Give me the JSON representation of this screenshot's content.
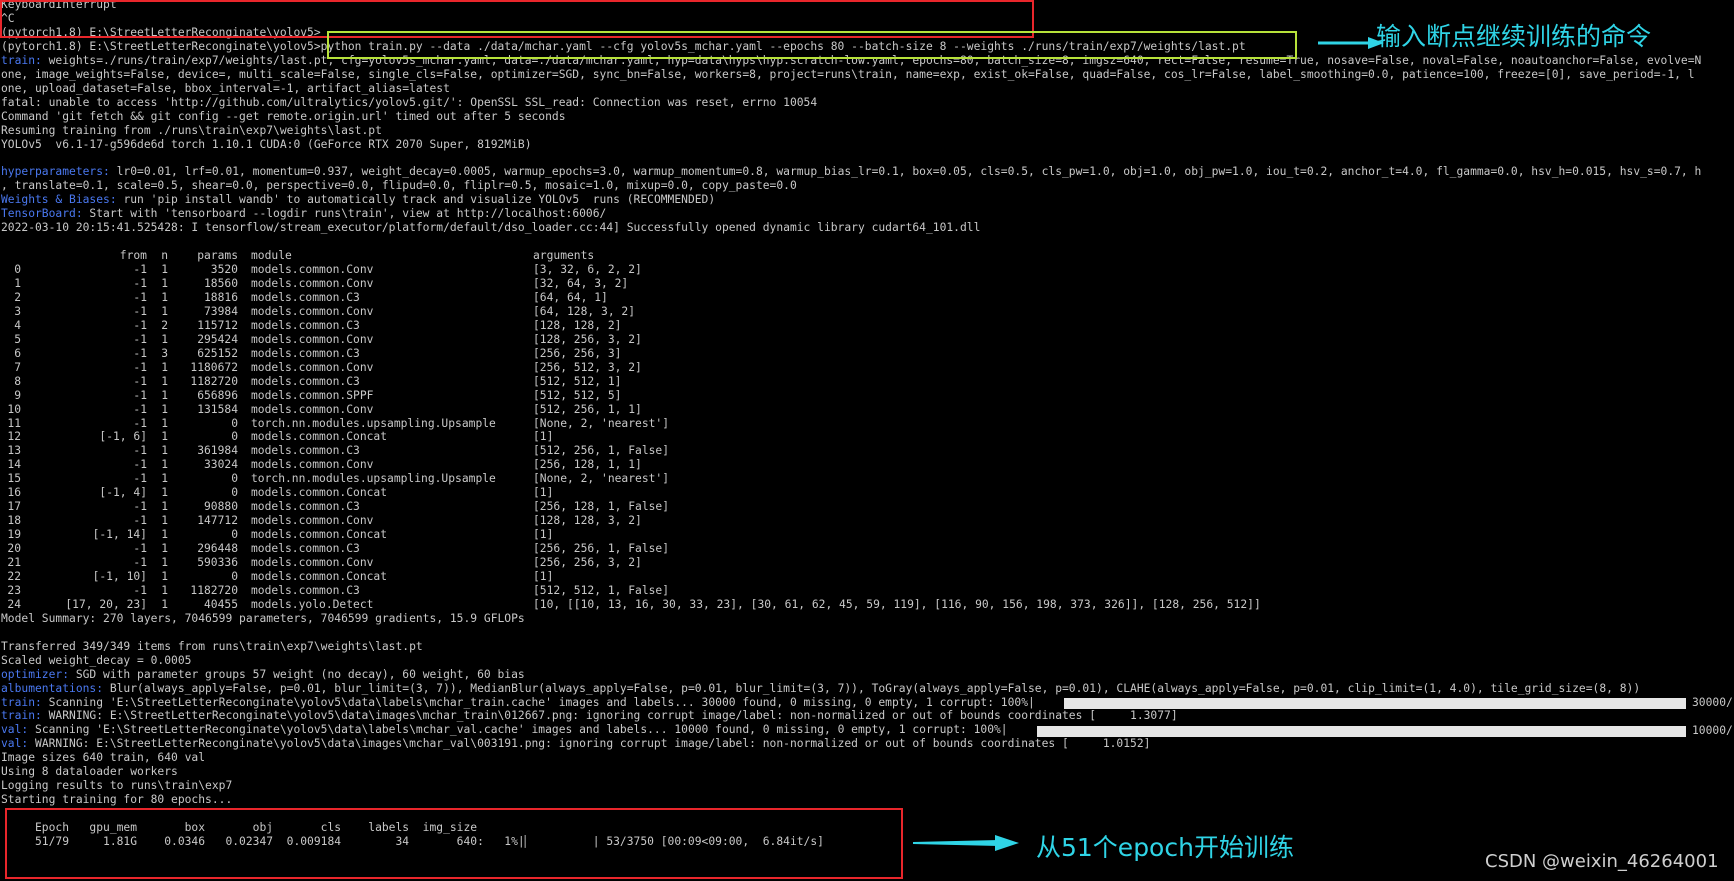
{
  "terminal": {
    "pre_lines": [
      {
        "prefix": "",
        "text": "KeyboardInterrupt"
      },
      {
        "prefix": "",
        "text": "^C"
      },
      {
        "prefix": "",
        "text": "(pytorch1.8) E:\\StreetLetterReconginate\\yolov5>"
      },
      {
        "prefix": "",
        "text": "(pytorch1.8) E:\\StreetLetterReconginate\\yolov5>python train.py --data ./data/mchar.yaml --cfg yolov5s_mchar.yaml --epochs 80 --batch-size 8 --weights ./runs/train/exp7/weights/last.pt"
      },
      {
        "prefix": "train: ",
        "text": "weights=./runs/train/exp7/weights/last.pt, cfg=yolov5s_mchar.yaml, data=./data/mchar.yaml, hyp=data\\hyps\\hyp.scratch-low.yaml, epochs=80, batch_size=8, imgsz=640, rect=False, resume=True, nosave=False, noval=False, noautoanchor=False, evolve=N"
      },
      {
        "prefix": "",
        "text": "one, image_weights=False, device=, multi_scale=False, single_cls=False, optimizer=SGD, sync_bn=False, workers=8, project=runs\\train, name=exp, exist_ok=False, quad=False, cos_lr=False, label_smoothing=0.0, patience=100, freeze=[0], save_period=-1, l"
      },
      {
        "prefix": "",
        "text": "one, upload_dataset=False, bbox_interval=-1, artifact_alias=latest"
      },
      {
        "prefix": "",
        "text": "fatal: unable to access 'http://github.com/ultralytics/yolov5.git/': OpenSSL SSL_read: Connection was reset, errno 10054"
      },
      {
        "prefix": "",
        "text": "Command 'git fetch && git config --get remote.origin.url' timed out after 5 seconds"
      },
      {
        "prefix": "",
        "text": "Resuming training from ./runs\\train\\exp7\\weights\\last.pt"
      },
      {
        "prefix": "",
        "text": "YOLOv5  v6.1-17-g596de6d torch 1.10.1 CUDA:0 (GeForce RTX 2070 Super, 8192MiB)"
      },
      {
        "prefix": "",
        "text": ""
      },
      {
        "prefix": "hyperparameters: ",
        "text": "lr0=0.01, lrf=0.01, momentum=0.937, weight_decay=0.0005, warmup_epochs=3.0, warmup_momentum=0.8, warmup_bias_lr=0.1, box=0.05, cls=0.5, cls_pw=1.0, obj=1.0, obj_pw=1.0, iou_t=0.2, anchor_t=4.0, fl_gamma=0.0, hsv_h=0.015, hsv_s=0.7, h"
      },
      {
        "prefix": "",
        "text": ", translate=0.1, scale=0.5, shear=0.0, perspective=0.0, flipud=0.0, fliplr=0.5, mosaic=1.0, mixup=0.0, copy_paste=0.0"
      },
      {
        "prefix": "Weights & Biases: ",
        "text": "run 'pip install wandb' to automatically track and visualize YOLOv5  runs (RECOMMENDED)"
      },
      {
        "prefix": "TensorBoard: ",
        "text": "Start with 'tensorboard --logdir runs\\train', view at http://localhost:6006/"
      },
      {
        "prefix": "",
        "text": "2022-03-10 20:15:41.525428: I tensorflow/stream_executor/platform/default/dso_loader.cc:44] Successfully opened dynamic library cudart64_101.dll"
      },
      {
        "prefix": "",
        "text": ""
      }
    ],
    "table": {
      "headers": {
        "from": "from",
        "n": "n",
        "params": "params",
        "module": "module",
        "arguments": "arguments"
      },
      "rows": [
        {
          "idx": "0",
          "from": "-1",
          "n": "1",
          "params": "3520",
          "module": "models.common.Conv",
          "args": "[3, 32, 6, 2, 2]"
        },
        {
          "idx": "1",
          "from": "-1",
          "n": "1",
          "params": "18560",
          "module": "models.common.Conv",
          "args": "[32, 64, 3, 2]"
        },
        {
          "idx": "2",
          "from": "-1",
          "n": "1",
          "params": "18816",
          "module": "models.common.C3",
          "args": "[64, 64, 1]"
        },
        {
          "idx": "3",
          "from": "-1",
          "n": "1",
          "params": "73984",
          "module": "models.common.Conv",
          "args": "[64, 128, 3, 2]"
        },
        {
          "idx": "4",
          "from": "-1",
          "n": "2",
          "params": "115712",
          "module": "models.common.C3",
          "args": "[128, 128, 2]"
        },
        {
          "idx": "5",
          "from": "-1",
          "n": "1",
          "params": "295424",
          "module": "models.common.Conv",
          "args": "[128, 256, 3, 2]"
        },
        {
          "idx": "6",
          "from": "-1",
          "n": "3",
          "params": "625152",
          "module": "models.common.C3",
          "args": "[256, 256, 3]"
        },
        {
          "idx": "7",
          "from": "-1",
          "n": "1",
          "params": "1180672",
          "module": "models.common.Conv",
          "args": "[256, 512, 3, 2]"
        },
        {
          "idx": "8",
          "from": "-1",
          "n": "1",
          "params": "1182720",
          "module": "models.common.C3",
          "args": "[512, 512, 1]"
        },
        {
          "idx": "9",
          "from": "-1",
          "n": "1",
          "params": "656896",
          "module": "models.common.SPPF",
          "args": "[512, 512, 5]"
        },
        {
          "idx": "10",
          "from": "-1",
          "n": "1",
          "params": "131584",
          "module": "models.common.Conv",
          "args": "[512, 256, 1, 1]"
        },
        {
          "idx": "11",
          "from": "-1",
          "n": "1",
          "params": "0",
          "module": "torch.nn.modules.upsampling.Upsample",
          "args": "[None, 2, 'nearest']"
        },
        {
          "idx": "12",
          "from": "[-1, 6]",
          "n": "1",
          "params": "0",
          "module": "models.common.Concat",
          "args": "[1]"
        },
        {
          "idx": "13",
          "from": "-1",
          "n": "1",
          "params": "361984",
          "module": "models.common.C3",
          "args": "[512, 256, 1, False]"
        },
        {
          "idx": "14",
          "from": "-1",
          "n": "1",
          "params": "33024",
          "module": "models.common.Conv",
          "args": "[256, 128, 1, 1]"
        },
        {
          "idx": "15",
          "from": "-1",
          "n": "1",
          "params": "0",
          "module": "torch.nn.modules.upsampling.Upsample",
          "args": "[None, 2, 'nearest']"
        },
        {
          "idx": "16",
          "from": "[-1, 4]",
          "n": "1",
          "params": "0",
          "module": "models.common.Concat",
          "args": "[1]"
        },
        {
          "idx": "17",
          "from": "-1",
          "n": "1",
          "params": "90880",
          "module": "models.common.C3",
          "args": "[256, 128, 1, False]"
        },
        {
          "idx": "18",
          "from": "-1",
          "n": "1",
          "params": "147712",
          "module": "models.common.Conv",
          "args": "[128, 128, 3, 2]"
        },
        {
          "idx": "19",
          "from": "[-1, 14]",
          "n": "1",
          "params": "0",
          "module": "models.common.Concat",
          "args": "[1]"
        },
        {
          "idx": "20",
          "from": "-1",
          "n": "1",
          "params": "296448",
          "module": "models.common.C3",
          "args": "[256, 256, 1, False]"
        },
        {
          "idx": "21",
          "from": "-1",
          "n": "1",
          "params": "590336",
          "module": "models.common.Conv",
          "args": "[256, 256, 3, 2]"
        },
        {
          "idx": "22",
          "from": "[-1, 10]",
          "n": "1",
          "params": "0",
          "module": "models.common.Concat",
          "args": "[1]"
        },
        {
          "idx": "23",
          "from": "-1",
          "n": "1",
          "params": "1182720",
          "module": "models.common.C3",
          "args": "[512, 512, 1, False]"
        },
        {
          "idx": "24",
          "from": "[17, 20, 23]",
          "n": "1",
          "params": "40455",
          "module": "models.yolo.Detect",
          "args": "[10, [[10, 13, 16, 30, 33, 23], [30, 61, 62, 45, 59, 119], [116, 90, 156, 198, 373, 326]], [128, 256, 512]]"
        }
      ]
    },
    "post_lines": [
      {
        "prefix": "",
        "text": "Model Summary: 270 layers, 7046599 parameters, 7046599 gradients, 15.9 GFLOPs"
      },
      {
        "prefix": "",
        "text": ""
      },
      {
        "prefix": "",
        "text": "Transferred 349/349 items from runs\\train\\exp7\\weights\\last.pt"
      },
      {
        "prefix": "",
        "text": "Scaled weight_decay = 0.0005"
      },
      {
        "prefix": "optimizer: ",
        "text": "SGD with parameter groups 57 weight (no decay), 60 weight, 60 bias"
      },
      {
        "prefix": "albumentations: ",
        "text": "Blur(always_apply=False, p=0.01, blur_limit=(3, 7)), MedianBlur(always_apply=False, p=0.01, blur_limit=(3, 7)), ToGray(always_apply=False, p=0.01), CLAHE(always_apply=False, p=0.01, clip_limit=(1, 4.0), tile_grid_size=(8, 8))"
      },
      {
        "prefix": "train: ",
        "text": "Scanning 'E:\\StreetLetterReconginate\\yolov5\\data\\labels\\mchar_train.cache' images and labels... 30000 found, 0 missing, 0 empty, 1 corrupt: 100%|"
      },
      {
        "prefix": "train: ",
        "text": "WARNING: E:\\StreetLetterReconginate\\yolov5\\data\\images\\mchar_train\\012667.png: ignoring corrupt image/label: non-normalized or out of bounds coordinates [     1.3077]"
      },
      {
        "prefix": "val: ",
        "text": "Scanning 'E:\\StreetLetterReconginate\\yolov5\\data\\labels\\mchar_val.cache' images and labels... 10000 found, 0 missing, 0 empty, 1 corrupt: 100%|"
      },
      {
        "prefix": "val: ",
        "text": "WARNING: E:\\StreetLetterReconginate\\yolov5\\data\\images\\mchar_val\\003191.png: ignoring corrupt image/label: non-normalized or out of bounds coordinates [     1.0152]"
      },
      {
        "prefix": "",
        "text": "Image sizes 640 train, 640 val"
      },
      {
        "prefix": "",
        "text": "Using 8 dataloader workers"
      },
      {
        "prefix": "",
        "text": "Logging results to runs\\train\\exp7"
      },
      {
        "prefix": "",
        "text": "Starting training for 80 epochs..."
      },
      {
        "prefix": "",
        "text": ""
      },
      {
        "prefix": "",
        "text": "     Epoch   gpu_mem       box       obj       cls    labels  img_size"
      },
      {
        "prefix": "",
        "text": "     51/79     1.81G    0.0346   0.02347  0.009184        34       640:   1%|▏         | 53/3750 [00:09<09:00,  6.84it/s]"
      }
    ],
    "progress": {
      "train_scan_count": "30000/",
      "val_scan_count": "10000/",
      "train_scan_fraction": 1.0,
      "val_scan_fraction": 1.0
    }
  },
  "annotations": {
    "resume_command_label": "输入断点继续训练的命令",
    "epoch_start_label": "从51个epoch开始训练",
    "watermark": "CSDN @weixin_46264001"
  },
  "colors": {
    "background": "#000000",
    "text": "#c8c8c8",
    "prefix_blue": "#4a78f0",
    "annotation_cyan": "#2fd4e6",
    "box_red": "#e8262b",
    "box_green": "#b7e23a"
  }
}
